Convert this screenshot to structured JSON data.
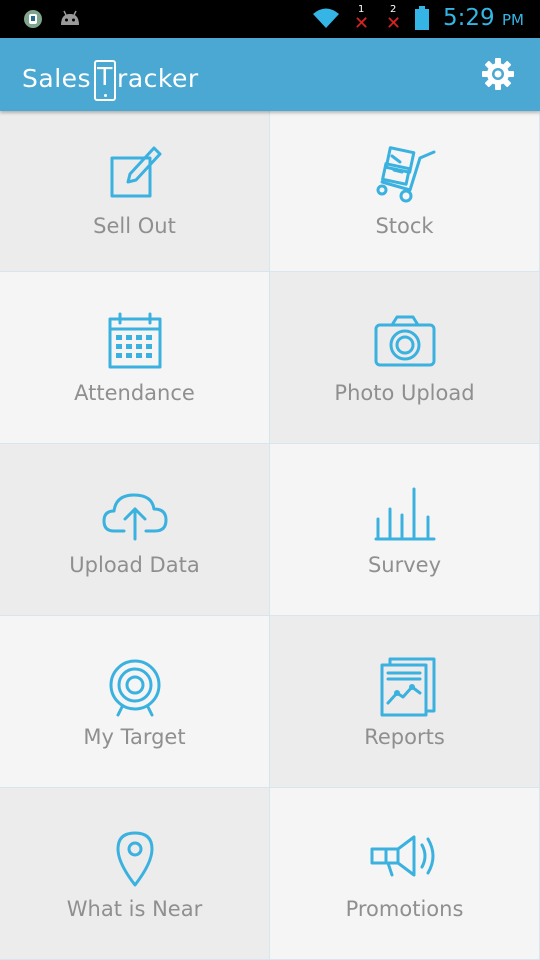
{
  "status_bar": {
    "sim1_label": "1",
    "sim2_label": "2",
    "time": "5:29",
    "ampm": "PM",
    "accent_color": "#35b5e5"
  },
  "app_bar": {
    "title_pre": "Sales",
    "title_letter": "T",
    "title_post": "racker",
    "background": "#4aa8d2",
    "settings_icon": "gear-icon"
  },
  "menu": {
    "tiles": [
      {
        "label": "Sell Out",
        "icon": "edit-icon"
      },
      {
        "label": "Stock",
        "icon": "hand-truck-icon"
      },
      {
        "label": "Attendance",
        "icon": "calendar-icon"
      },
      {
        "label": "Photo Upload",
        "icon": "camera-icon"
      },
      {
        "label": "Upload Data",
        "icon": "cloud-upload-icon"
      },
      {
        "label": "Survey",
        "icon": "bar-chart-icon"
      },
      {
        "label": "My Target",
        "icon": "target-icon"
      },
      {
        "label": "Reports",
        "icon": "report-icon"
      },
      {
        "label": "What is Near",
        "icon": "map-pin-icon"
      },
      {
        "label": "Promotions",
        "icon": "megaphone-icon"
      }
    ],
    "icon_color": "#3bb1e0",
    "label_color": "#8f8f8f"
  }
}
